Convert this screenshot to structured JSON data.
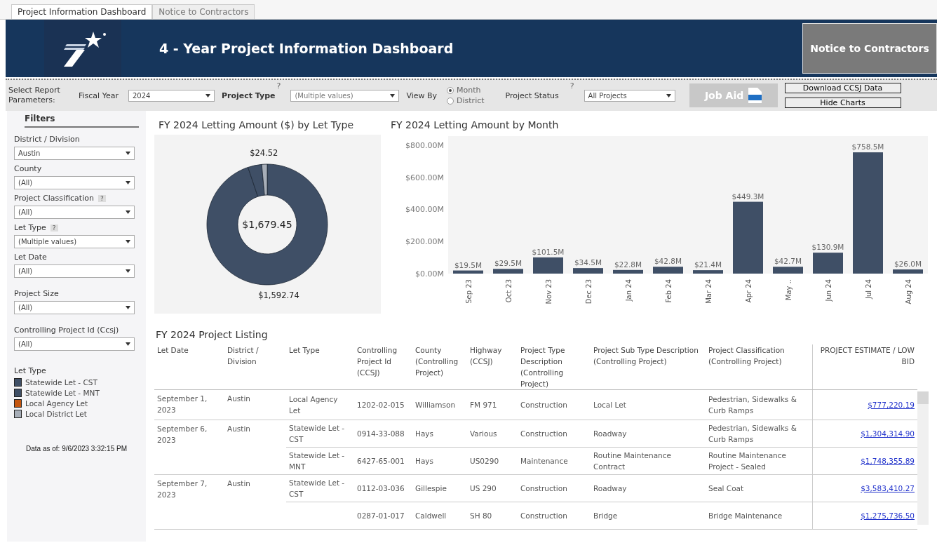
{
  "tabs": [
    {
      "label": "Project Information Dashboard",
      "selected": true
    },
    {
      "label": "Notice to Contractors",
      "selected": false
    }
  ],
  "header": {
    "title": "4 - Year Project Information Dashboard",
    "notice_button": "Notice to Contractors"
  },
  "parameters": {
    "label": "Select Report Parameters:",
    "fiscal_year": {
      "label": "Fiscal Year",
      "value": "2024"
    },
    "project_type": {
      "label": "Project Type",
      "help": "?",
      "value": "(Multiple values)"
    },
    "view_by": {
      "label": "View By",
      "options": [
        {
          "label": "Month",
          "selected": true
        },
        {
          "label": "District",
          "selected": false
        }
      ]
    },
    "project_status": {
      "label": "Project Status",
      "help": "?",
      "value": "All Projects"
    },
    "job_aid": "Job Aid",
    "download": "Download CCSJ Data",
    "hide_charts": "Hide Charts"
  },
  "filters": {
    "title": "Filters",
    "items": [
      {
        "label": "District / Division",
        "value": "Austin"
      },
      {
        "label": "County",
        "value": "(All)"
      },
      {
        "label": "Project Classification",
        "help": "?",
        "value": "(All)"
      },
      {
        "label": "Let Type",
        "help": "?",
        "value": "(Multiple values)"
      },
      {
        "label": "Let Date",
        "value": "(All)"
      },
      {
        "label": "Project Size",
        "value": "(All)"
      },
      {
        "label": "Controlling Project Id (Ccsj)",
        "value": "(All)"
      }
    ],
    "legend_title": "Let Type",
    "legend": [
      {
        "label": "Statewide Let - CST",
        "color": "#3f4f66"
      },
      {
        "label": "Statewide Let - MNT",
        "color": "#3f4f66"
      },
      {
        "label": "Local Agency Let",
        "color": "#c5560f"
      },
      {
        "label": "Local District Let",
        "color": "#a7aeb8"
      }
    ],
    "data_as_of": "Data as of: 9/6/2023 3:32:15 PM"
  },
  "donut": {
    "title": "FY 2024 Letting Amount ($) by Let Type",
    "center_label": "$1,679.45",
    "chart_data": {
      "type": "donut",
      "values": [
        1592.74,
        62.19,
        24.52
      ],
      "colors": [
        "#3f4f66",
        "#3f4f66",
        "#a7aeb8"
      ],
      "value_labels": [
        "$1,592.74",
        null,
        "$24.52"
      ]
    }
  },
  "bars": {
    "title": "FY 2024  Letting Amount by Month",
    "chart_data": {
      "type": "bar",
      "categories": [
        "Sep 23",
        "Oct 23",
        "Nov 23",
        "Dec 23",
        "Jan 24",
        "Feb 24",
        "Mar 24",
        "Apr 24",
        "May ..",
        "Jun 24",
        "Jul 24",
        "Aug 24"
      ],
      "series": [
        {
          "color": "#3f4f66",
          "values": [
            19.5,
            29.5,
            101.5,
            34.5,
            22.8,
            42.8,
            21.4,
            449.3,
            42.7,
            130.9,
            758.5,
            26.0
          ]
        }
      ],
      "ylim": [
        0,
        860
      ],
      "yticks": [
        {
          "value": 0,
          "label": "$0.00M"
        },
        {
          "value": 200,
          "label": "$200.00M"
        },
        {
          "value": 400,
          "label": "$400.00M"
        },
        {
          "value": 600,
          "label": "$600.00M"
        },
        {
          "value": 800,
          "label": "$800.00M"
        }
      ],
      "value_labels": [
        "$19.5M",
        "$29.5M",
        "$101.5M",
        "$34.5M",
        "$22.8M",
        "$42.8M",
        "$21.4M",
        "$449.3M",
        "$42.7M",
        "$130.9M",
        "$758.5M",
        "$26.0M"
      ]
    }
  },
  "listing": {
    "title": "FY 2024 Project Listing",
    "columns": [
      "Let Date",
      "District / Division",
      "Let Type",
      "Controlling Project Id (CCSJ)",
      "County (Controlling Project)",
      "Highway (CCSJ)",
      "Project Type Description (Controlling Project)",
      "Project Sub Type Description (Controlling Project)",
      "Project Classification (Controlling Project)",
      "PROJECT ESTIMATE / LOW BID"
    ],
    "groups": [
      {
        "let_date": "September 1, 2023",
        "district": "Austin",
        "projects": [
          {
            "let_type": "Local Agency Let",
            "ccsj": "1202-02-015",
            "county": "Williamson",
            "highway": "FM 971",
            "type": "Construction",
            "sub_type": "Local Let",
            "classification": "Pedestrian, Sidewalks & Curb Ramps",
            "estimate": "$777,220.19"
          }
        ]
      },
      {
        "let_date": "September 6, 2023",
        "district": "Austin",
        "projects": [
          {
            "let_type": "Statewide Let - CST",
            "ccsj": "0914-33-088",
            "county": "Hays",
            "highway": "Various",
            "type": "Construction",
            "sub_type": "Roadway",
            "classification": "Pedestrian, Sidewalks & Curb Ramps",
            "estimate": "$1,304,314.90"
          },
          {
            "let_type": "Statewide Let - MNT",
            "ccsj": "6427-65-001",
            "county": "Hays",
            "highway": "US0290",
            "type": "Maintenance",
            "sub_type": "Routine Maintenance Contract",
            "classification": "Routine Maintenance Project - Sealed",
            "estimate": "$1,748,355.89"
          }
        ]
      },
      {
        "let_date": "September 7, 2023",
        "district": "Austin",
        "projects": [
          {
            "let_type": "Statewide Let - CST",
            "ccsj": "0112-03-036",
            "county": "Gillespie",
            "highway": "US 290",
            "type": "Construction",
            "sub_type": "Roadway",
            "classification": "Seal Coat",
            "estimate": "$3,583,410.27"
          },
          {
            "ccsj": "0287-01-017",
            "county": "Caldwell",
            "highway": "SH 80",
            "type": "Construction",
            "sub_type": "Bridge",
            "classification": "Bridge Maintenance",
            "estimate": "$1,275,736.50"
          }
        ]
      }
    ]
  }
}
